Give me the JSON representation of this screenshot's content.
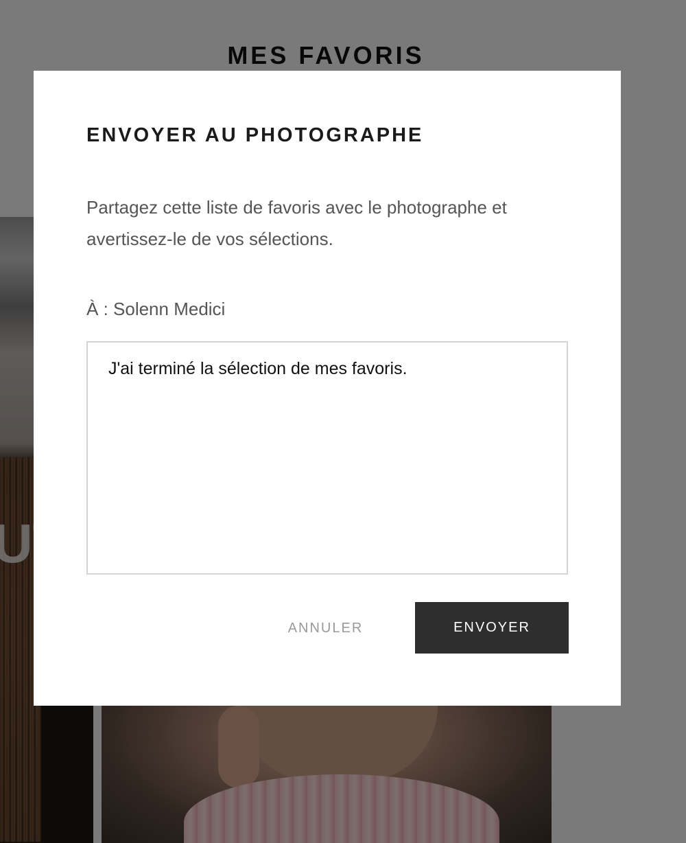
{
  "page": {
    "title": "MES FAVORIS",
    "photo_overlay_text": "UT"
  },
  "modal": {
    "title": "ENVOYER AU PHOTOGRAPHE",
    "description": "Partagez cette liste de favoris avec le photographe et avertissez-le de vos sélections.",
    "recipient": "À : Solenn Medici",
    "message_value": "J'ai terminé la sélection de mes favoris.",
    "cancel_label": "ANNULER",
    "send_label": "ENVOYER"
  },
  "colors": {
    "overlay": "#808080",
    "send_button": "#2e2e2e",
    "cancel_text": "#999999"
  }
}
